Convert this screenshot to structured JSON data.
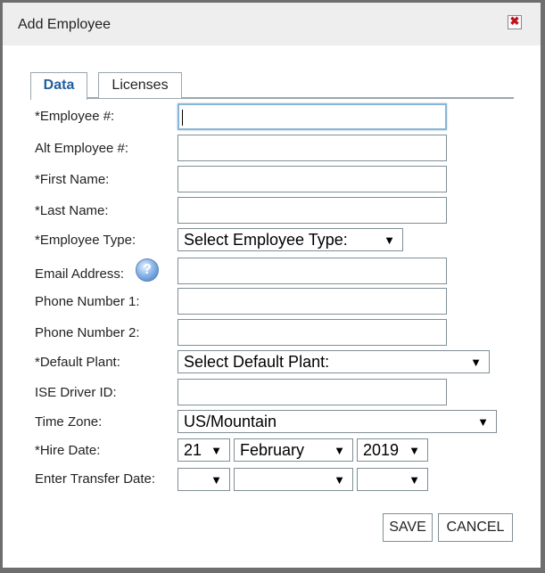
{
  "dialog": {
    "title": "Add Employee"
  },
  "tabs": [
    {
      "label": "Data"
    },
    {
      "label": "Licenses"
    }
  ],
  "fields": {
    "employee_num": {
      "label": "*Employee #:",
      "value": ""
    },
    "alt_employee_num": {
      "label": "Alt Employee #:",
      "value": ""
    },
    "first_name": {
      "label": "*First Name:",
      "value": ""
    },
    "last_name": {
      "label": "*Last Name:",
      "value": ""
    },
    "employee_type": {
      "label": "*Employee Type:",
      "value": "Select Employee Type:"
    },
    "email": {
      "label": "Email Address:",
      "value": ""
    },
    "phone1": {
      "label": "Phone Number 1:",
      "value": ""
    },
    "phone2": {
      "label": "Phone Number 2:",
      "value": ""
    },
    "default_plant": {
      "label": "*Default Plant:",
      "value": "Select Default Plant:"
    },
    "ise_driver_id": {
      "label": "ISE Driver ID:",
      "value": ""
    },
    "time_zone": {
      "label": "Time Zone:",
      "value": "US/Mountain"
    },
    "hire_date": {
      "label": "*Hire Date:",
      "day": "21",
      "month": "February",
      "year": "2019"
    },
    "transfer_date": {
      "label": "Enter Transfer Date:",
      "day": "",
      "month": "",
      "year": ""
    }
  },
  "icons": {
    "close": "close-icon",
    "help": "help-icon"
  },
  "help_glyph": "?",
  "close_glyph": "✖",
  "dropdown_glyph": "▼",
  "buttons": {
    "save": "SAVE",
    "cancel": "CANCEL"
  },
  "colors": {
    "tab_active": "#1f5f9e",
    "close_x": "#c0121e",
    "focus_border": "#8ab6d6"
  }
}
